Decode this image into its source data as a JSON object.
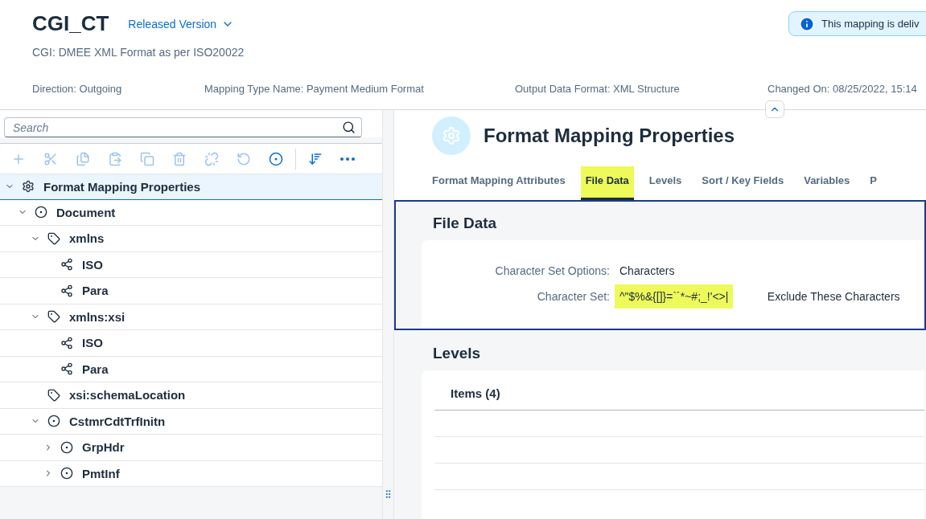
{
  "header": {
    "title": "CGI_CT",
    "version": "Released Version",
    "subtitle": "CGI: DMEE XML Format as per ISO20022",
    "info": "This mapping is deliv",
    "attributes": [
      "Direction: Outgoing",
      "Mapping Type Name: Payment Medium Format",
      "Output Data Format: XML Structure",
      "Changed On: 08/25/2022, 15:14"
    ]
  },
  "tree_panel": {
    "search": {
      "placeholder": "Search"
    },
    "toolbar": [
      {
        "kind": "add",
        "disabled": true
      },
      {
        "kind": "cut",
        "disabled": true
      },
      {
        "kind": "copy",
        "disabled": true
      },
      {
        "kind": "paste",
        "disabled": true
      },
      {
        "kind": "duplicate",
        "disabled": true
      },
      {
        "kind": "delete",
        "disabled": true
      },
      {
        "kind": "unlink",
        "disabled": true
      },
      {
        "kind": "reset",
        "disabled": true
      },
      {
        "kind": "element",
        "disabled": false
      },
      {
        "kind": "sort",
        "disabled": false
      },
      {
        "kind": "more",
        "disabled": false
      }
    ],
    "tree": [
      {
        "label": "Format Mapping Properties",
        "kind": "settings",
        "expanded": true,
        "selected": true,
        "children": [
          {
            "label": "Document",
            "kind": "element",
            "expanded": true,
            "selected": false,
            "children": [
              {
                "label": "xmlns",
                "kind": "attribute",
                "expanded": true,
                "selected": false,
                "children": [
                  {
                    "label": "ISO",
                    "kind": "value",
                    "selected": false
                  },
                  {
                    "label": "Para",
                    "kind": "value",
                    "selected": false
                  }
                ]
              },
              {
                "label": "xmlns:xsi",
                "kind": "attribute",
                "expanded": true,
                "selected": false,
                "children": [
                  {
                    "label": "ISO",
                    "kind": "value",
                    "selected": false
                  },
                  {
                    "label": "Para",
                    "kind": "value",
                    "selected": false
                  }
                ]
              },
              {
                "label": "xsi:schemaLocation",
                "kind": "attribute",
                "selected": false
              },
              {
                "label": "CstmrCdtTrfInitn",
                "kind": "element",
                "expanded": true,
                "selected": false,
                "children": [
                  {
                    "label": "GrpHdr",
                    "kind": "element",
                    "expanded": false,
                    "selected": false
                  },
                  {
                    "label": "PmtInf",
                    "kind": "element",
                    "expanded": false,
                    "selected": false
                  }
                ]
              }
            ]
          }
        ]
      }
    ]
  },
  "detail": {
    "title": "Format Mapping Properties",
    "tabs": [
      {
        "label": "Format Mapping Attributes",
        "selected": false,
        "highlighted": false
      },
      {
        "label": "File Data",
        "selected": true,
        "highlighted": true
      },
      {
        "label": "Levels",
        "selected": false,
        "highlighted": false
      },
      {
        "label": "Sort / Key Fields",
        "selected": false,
        "highlighted": false
      },
      {
        "label": "Variables",
        "selected": false,
        "highlighted": false
      },
      {
        "label": "P",
        "selected": false,
        "highlighted": false
      }
    ],
    "file_data": {
      "title": "File Data",
      "fields": [
        {
          "label": "Character Set Options:",
          "value": "Characters",
          "highlighted": false
        },
        {
          "label": "Character Set:",
          "value": "^\"$%&{[]}=`´*~#;_!'<>|",
          "highlighted": true,
          "note": "Exclude These Characters"
        }
      ]
    },
    "levels": {
      "title": "Levels",
      "items_title": "Items (4)"
    }
  }
}
